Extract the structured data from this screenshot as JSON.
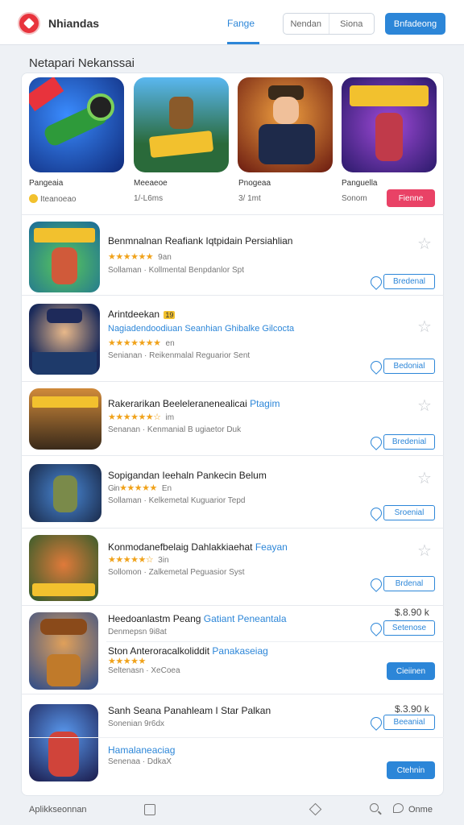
{
  "header": {
    "app_name": "Nhiandas",
    "tab_active": "Fange",
    "seg_left": "Nendan",
    "seg_right": "Siona",
    "signup_label": "Bnfadeong"
  },
  "section": {
    "title": "Netapari Nekanssai"
  },
  "featured": [
    {
      "label": "Pangeaia",
      "sub": "Iteanoeao",
      "has_coin": true
    },
    {
      "label": "Meeaeoe",
      "sub": "1/-L6ms"
    },
    {
      "label": "Pnogeaa",
      "sub": "3/ 1mt"
    },
    {
      "label": "Panguella",
      "sub": "Sonom",
      "button": "Fienne"
    }
  ],
  "list": [
    {
      "title": "Benmnalnan Reafiank Iqtpidain Persiahlian",
      "stars": "★★★★★★",
      "rating": "9an",
      "meta": "Sollaman · Kollmental Benpdanlor Spt",
      "action": "Bredenal",
      "favorite": true
    },
    {
      "title": "Arintdeekan",
      "title_badge": "19",
      "subtitle": "Nagiadendoodiuan Seanhian Ghibalke Gilcocta",
      "stars": "★★★★★★★",
      "rating": "en",
      "meta": "Senianan · Reikenmalal Reguarior Sent",
      "action": "Bedonial",
      "favorite": true
    },
    {
      "title": "Rakerarikan Beeleleranenealicai",
      "title_link": "Ptagim",
      "stars": "★★★★★★☆",
      "rating": "im",
      "meta": "Senanan · Kenmanial B ugiaetor Duk",
      "action": "Bredenial",
      "favorite": true
    },
    {
      "title": "Sopigandan Ieehaln Pankecin Belum",
      "stars": "★★★★★",
      "stars_prefix": "Gin",
      "rating": "En",
      "meta": "Sollaman · Kelkemetal Kuguarior Tepd",
      "action": "Sroenial",
      "favorite": true
    },
    {
      "title": "Konmodanefbelaig Dahlakkiaehat",
      "title_link": "Feayan",
      "stars": "★★★★★☆",
      "rating": "3in",
      "meta": "Sollomon · Zalkemetal Peguasior Syst",
      "action": "Brdenal",
      "favorite": true
    },
    {
      "title": "Heedoanlastm Peang",
      "title_link": "Gatiant Peneantala",
      "price": "$.8.90 k",
      "sub1": "Denmepsn 9i8at",
      "action": "Setenose",
      "title2": "Ston Anteroracalkoliddit",
      "title2_link": "Panakaseiag",
      "stars": "★★★★★",
      "meta": "Seltenasn · XeCoea",
      "button": "Cieiinen"
    },
    {
      "title": "Sanh Seana Panahleam I Star Palkan",
      "price": "$.3.90 k",
      "sub1": "Sonenian 9r6dx",
      "action": "Beeanial",
      "title2": "Hamalaneaciag",
      "meta": "Senenaa · DdkaX",
      "button": "Ctehnin"
    }
  ],
  "bottom": {
    "left_label": "Aplikkseonnan",
    "more_label": "Onme"
  },
  "colors": {
    "accent": "#2c86d8",
    "pink": "#e94266",
    "star": "#f0a21a",
    "logo": "#e8333c"
  }
}
